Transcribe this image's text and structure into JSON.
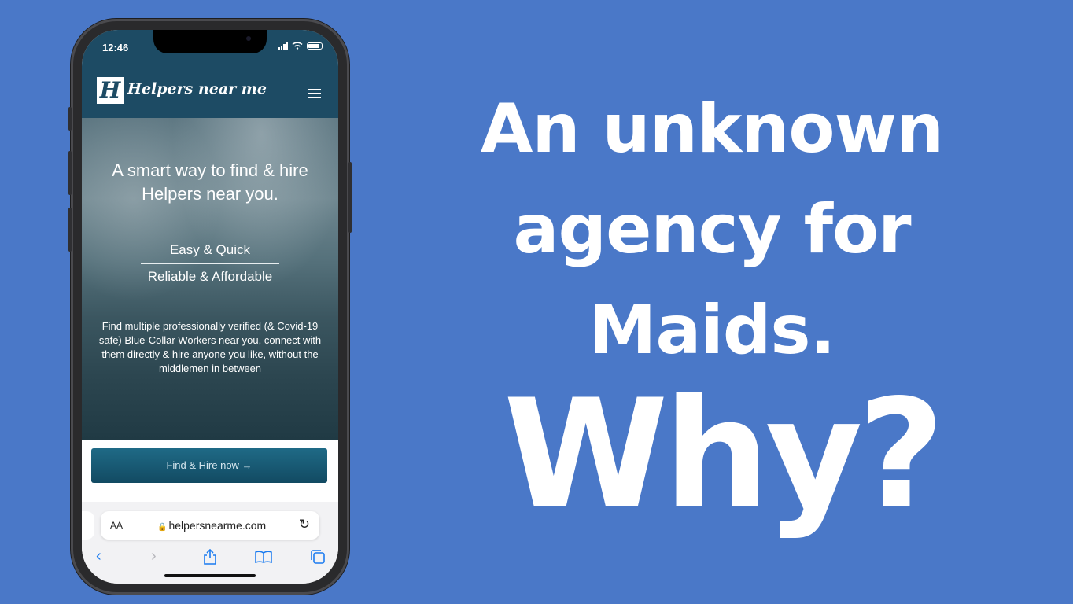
{
  "headline": {
    "line1": "An unknown",
    "line2": "agency for Maids.",
    "why": "Why?"
  },
  "status_bar": {
    "time": "12:46"
  },
  "site": {
    "logo_letter": "H",
    "logo_text": "Helpers near me",
    "hero_title": "A smart way to find & hire Helpers near you.",
    "tagline_1": "Easy & Quick",
    "tagline_2": "Reliable & Affordable",
    "description": "Find multiple professionally verified (& Covid-19 safe) Blue-Collar Workers near you, connect with them directly & hire anyone you like, without the middlemen in between",
    "cta_label": "Find & Hire now →",
    "cta_behind_text": "Find & Hire"
  },
  "browser": {
    "text_size_label": "AA",
    "url": "helpersnearme.com",
    "reload_icon": "reload-icon",
    "toolbar_icons": [
      "back-icon",
      "forward-icon",
      "share-icon",
      "bookmarks-icon",
      "tabs-icon"
    ]
  },
  "colors": {
    "background": "#4a78c8",
    "header": "#1d4b64",
    "link": "#1a7bf0"
  }
}
